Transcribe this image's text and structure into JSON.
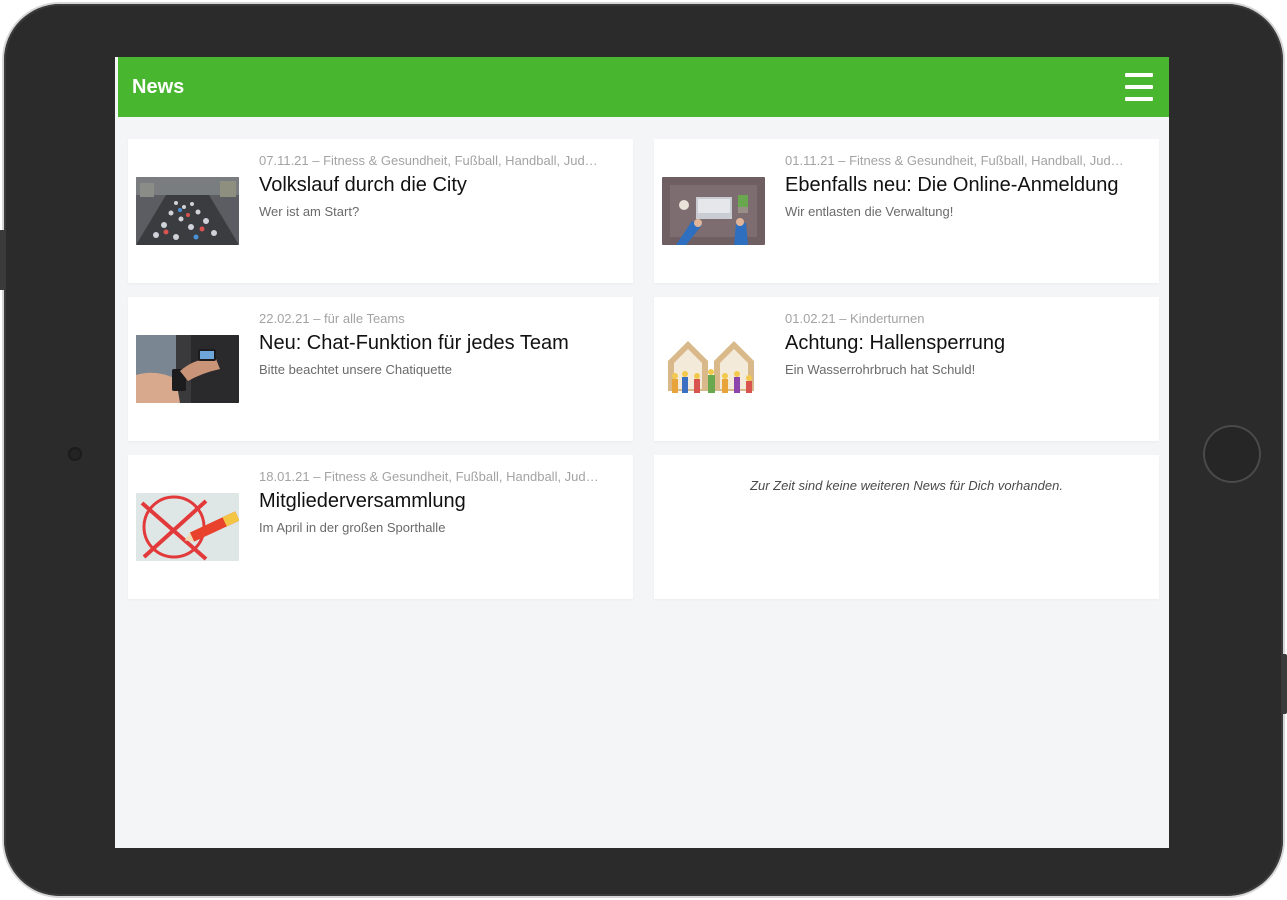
{
  "header": {
    "title": "News",
    "menu_icon": "hamburger-menu-icon"
  },
  "news": [
    {
      "meta": "07.11.21 – Fitness & Gesundheit, Fußball, Handball, Jud…",
      "title": "Volkslauf durch die City",
      "subtitle": "Wer ist am Start?"
    },
    {
      "meta": "01.11.21 – Fitness & Gesundheit, Fußball, Handball, Jud…",
      "title": "Ebenfalls neu: Die Online-Anmeldung",
      "subtitle": "Wir entlasten die Verwaltung!"
    },
    {
      "meta": "22.02.21 – für alle Teams",
      "title": "Neu: Chat-Funktion für jedes Team",
      "subtitle": "Bitte beachtet unsere Chatiquette"
    },
    {
      "meta": "01.02.21 – Kinderturnen",
      "title": "Achtung: Hallensperrung",
      "subtitle": "Ein Wasserrohrbruch hat Schuld!"
    },
    {
      "meta": "18.01.21 – Fitness & Gesundheit, Fußball, Handball, Jud…",
      "title": "Mitgliederversammlung",
      "subtitle": "Im April in der großen Sporthalle"
    }
  ],
  "empty_message": "Zur Zeit sind keine weiteren News für Dich vorhanden.",
  "colors": {
    "header_green": "#49b630",
    "background": "#f4f5f7",
    "device_frame": "#2b2b2b"
  }
}
